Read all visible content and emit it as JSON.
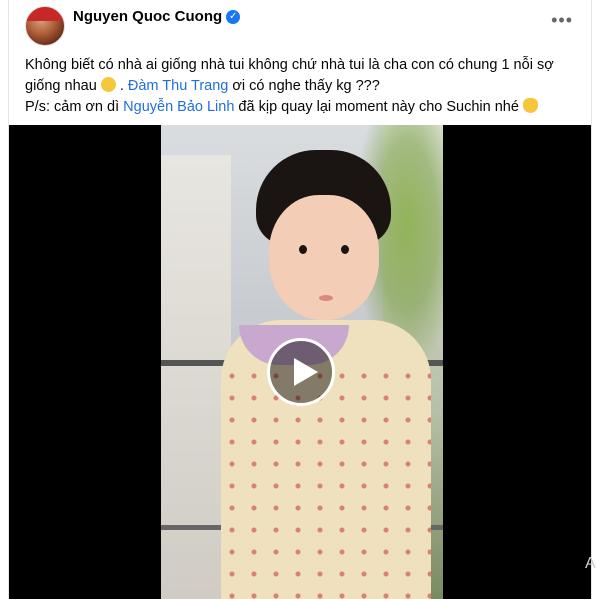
{
  "post": {
    "author": "Nguyen Quoc Cuong",
    "more_label": "•••",
    "line1": "Không biết có nhà ai giống nhà tui không chứ nhà tui là cha con có chung 1 nỗi sợ giống nhau",
    "line1_sep": " . ",
    "mention1": "Đàm Thu Trang",
    "line1_tail": " ơi có nghe thấy kg ???",
    "line2_prefix": "P/s: cảm ơn dì ",
    "mention2": "Nguyễn Bảo Linh",
    "line2_tail": " đã kịp quay lại moment này cho Suchin nhé"
  },
  "video": {
    "play_label": "Play video"
  },
  "edge_char": "A"
}
